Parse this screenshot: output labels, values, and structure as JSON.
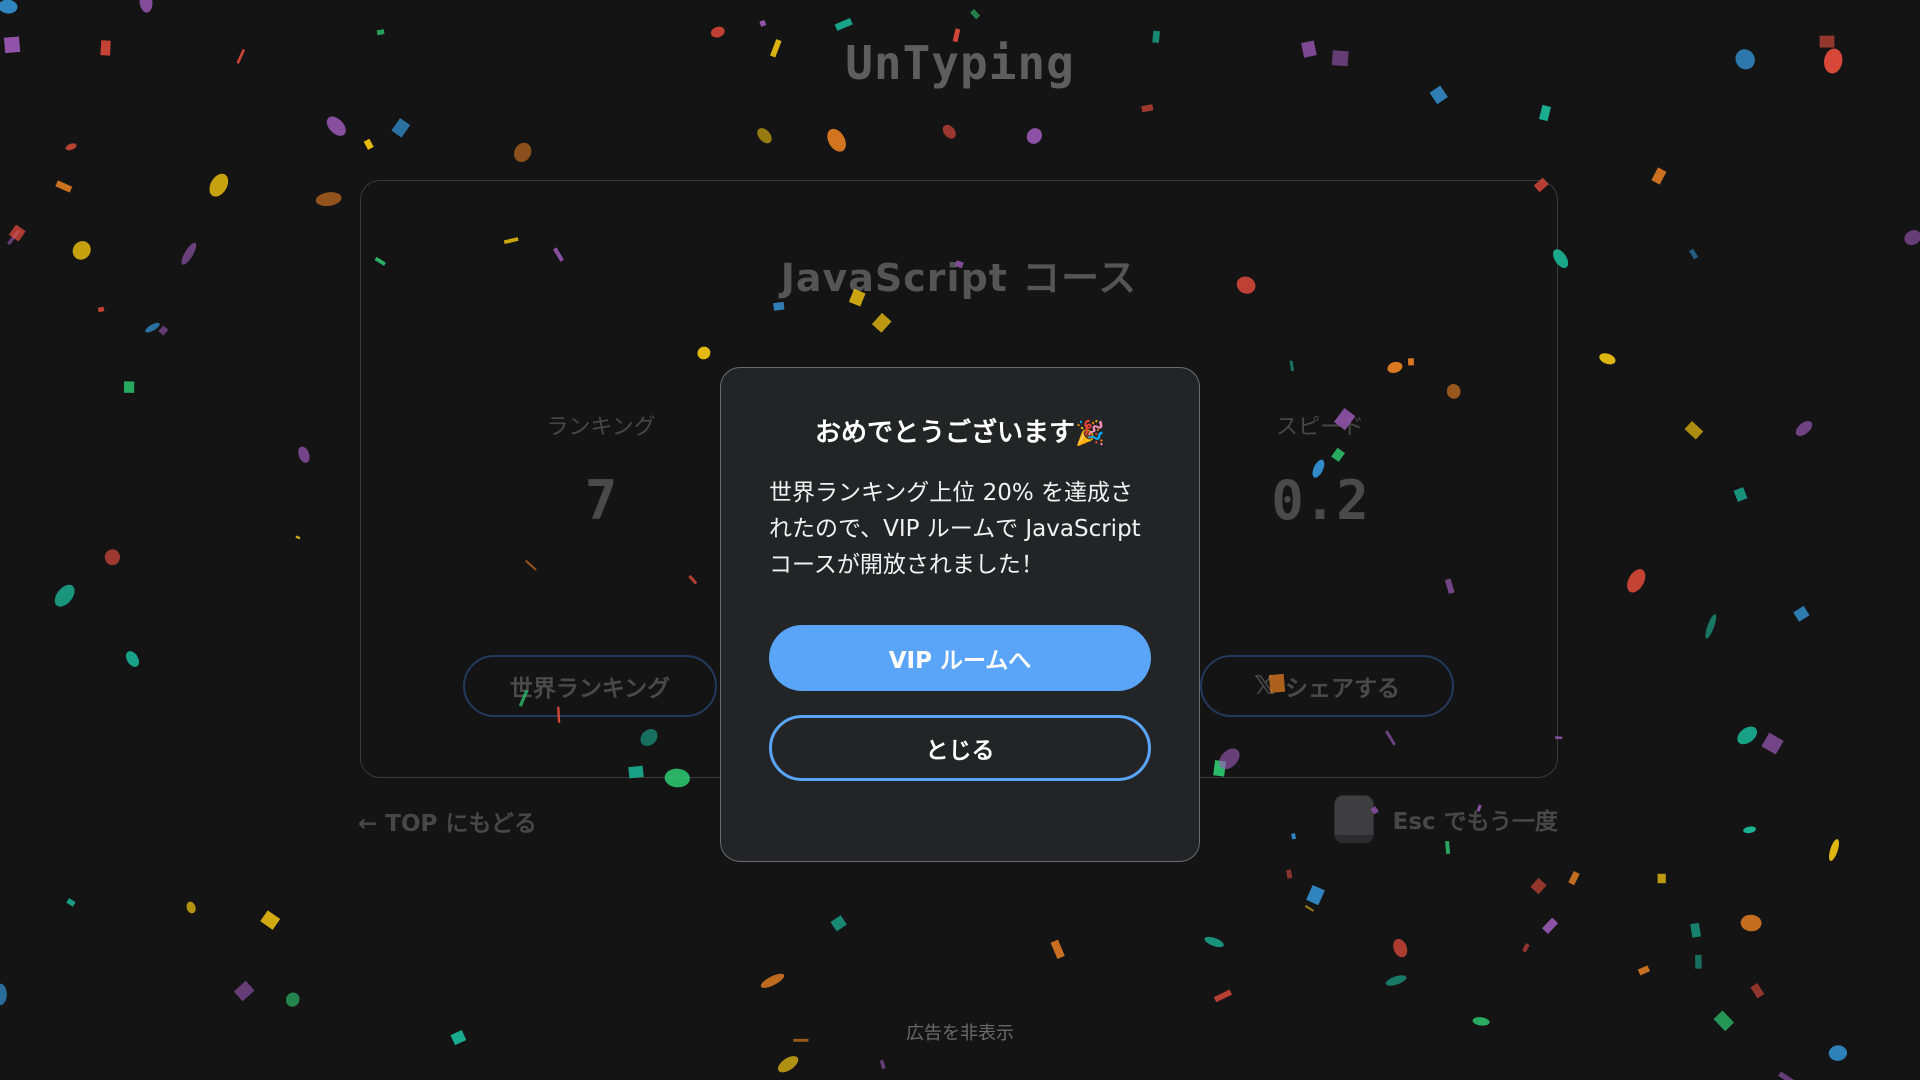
{
  "app": {
    "logo": "UnTyping"
  },
  "result": {
    "course_title": "JavaScript コース",
    "ranking_label": "ランキング",
    "ranking_value": "7",
    "speed_label": "スピード",
    "speed_value": "0.2",
    "world_ranking_button": "世界ランキング",
    "share_button": "シェアする",
    "share_icon": "x-logo-icon"
  },
  "footer": {
    "back_link": "← TOP にもどる",
    "retry_text": "Esc でもう一度",
    "retry_key_icon": "keyboard-key-icon",
    "hide_ads": "広告を非表示"
  },
  "modal": {
    "title": "おめでとうございます",
    "title_emoji": "🎉",
    "message": "世界ランキング上位 20% を達成されたので、VIP ルームで JavaScript コースが開放されました！",
    "primary_button": "VIP ルームへ",
    "close_button": "とじる"
  },
  "colors": {
    "background": "#141415",
    "modal_bg": "#232425",
    "accent": "#5ba5f8",
    "outline_button_border": "#23395d",
    "dim_text": "#4a4a4a",
    "confetti": [
      "#e74c3c",
      "#f1c40f",
      "#3498db",
      "#2ecc71",
      "#9b59b6",
      "#e67e22",
      "#1abc9c"
    ]
  }
}
